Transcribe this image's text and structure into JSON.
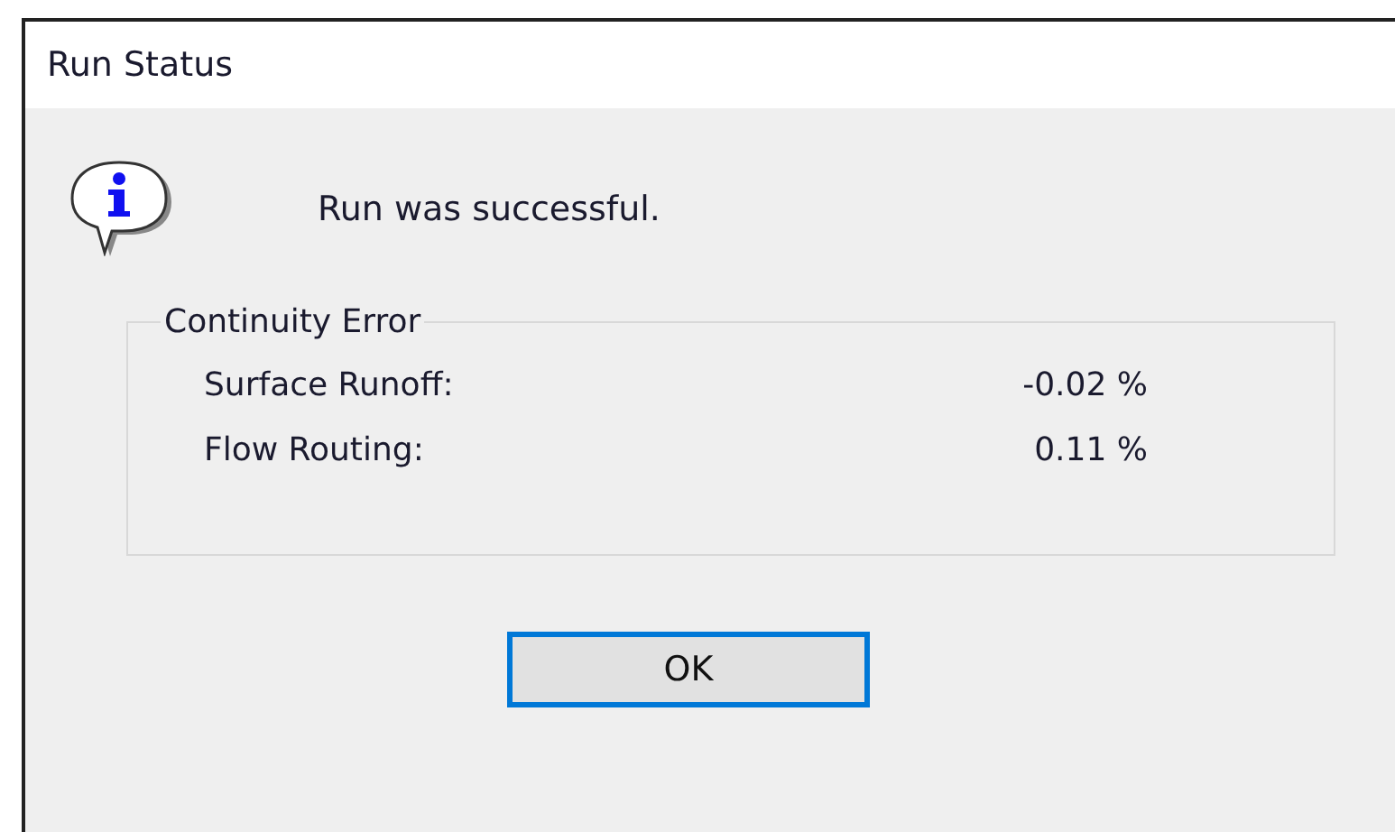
{
  "window": {
    "title": "Run Status"
  },
  "message": "Run was successful.",
  "group": {
    "title": "Continuity Error",
    "rows": [
      {
        "label": "Surface Runoff:",
        "value": "-0.02 %"
      },
      {
        "label": "Flow Routing:",
        "value": "0.11 %"
      }
    ]
  },
  "buttons": [
    {
      "label": "OK",
      "focused": true
    }
  ]
}
